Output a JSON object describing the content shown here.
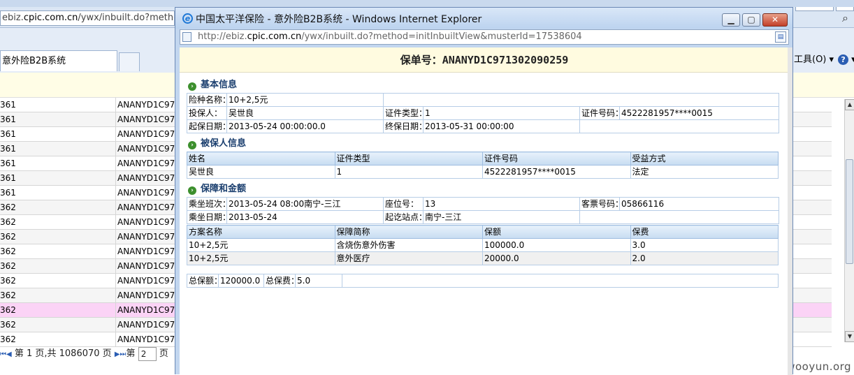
{
  "background": {
    "address_url_prefix": "ebiz.",
    "address_url_domain": "cpic.com.cn",
    "address_url_rest": "/ywx/inbuilt.do?method=",
    "tab_label": "意外险B2B系统",
    "tools_menu": "工具(O) ▾",
    "help_label": "?",
    "rows": [
      {
        "c1": "361",
        "c2": "ANANYD1C97"
      },
      {
        "c1": "361",
        "c2": "ANANYD1C97"
      },
      {
        "c1": "361",
        "c2": "ANANYD1C97"
      },
      {
        "c1": "361",
        "c2": "ANANYD1C97"
      },
      {
        "c1": "361",
        "c2": "ANANYD1C97"
      },
      {
        "c1": "361",
        "c2": "ANANYD1C97"
      },
      {
        "c1": "361",
        "c2": "ANANYD1C97"
      },
      {
        "c1": "362",
        "c2": "ANANYD1C97"
      },
      {
        "c1": "362",
        "c2": "ANANYD1C97"
      },
      {
        "c1": "362",
        "c2": "ANANYD1C97"
      },
      {
        "c1": "362",
        "c2": "ANANYD1C97"
      },
      {
        "c1": "362",
        "c2": "ANANYD1C97"
      },
      {
        "c1": "362",
        "c2": "ANANYD1C97"
      },
      {
        "c1": "362",
        "c2": "ANANYD1C97"
      },
      {
        "c1": "362",
        "c2": "ANANYD1C97"
      },
      {
        "c1": "362",
        "c2": "ANANYD1C97"
      },
      {
        "c1": "362",
        "c2": "ANANYD1C97"
      }
    ],
    "highlight_row_index": 14,
    "pager": {
      "first_icon": "⏮",
      "prev_icon": "◀",
      "text": "第 1 页,共 1086070 页",
      "next_icon": "▶",
      "last_icon": "⏭",
      "goto_prefix": "第",
      "goto_value": "2",
      "goto_suffix": "页"
    }
  },
  "popup": {
    "title": "中国太平洋保险 - 意外险B2B系统 - Windows Internet Explorer",
    "url_prefix": "http://ebiz.",
    "url_domain": "cpic.com.cn",
    "url_rest": "/ywx/inbuilt.do?method=initInbuiltView&musterId=17538604",
    "policy_label": "保单号：",
    "policy_no": "ANANYD1C971302090259",
    "basic": {
      "title": "基本信息",
      "insurance_name_label": "险种名称：",
      "insurance_name": "10+2,5元",
      "applicant_label": "投保人：",
      "applicant": "吴世良",
      "id_type_label": "证件类型：",
      "id_type": "1",
      "id_no_label": "证件号码：",
      "id_no": "4522281957****0015",
      "start_label": "起保日期：",
      "start": "2013-05-24 00:00:00.0",
      "end_label": "终保日期：",
      "end": "2013-05-31 00:00:00"
    },
    "insured": {
      "title": "被保人信息",
      "headers": [
        "姓名",
        "证件类型",
        "证件号码",
        "受益方式"
      ],
      "row": [
        "吴世良",
        "1",
        "4522281957****0015",
        "法定"
      ]
    },
    "coverage": {
      "title": "保障和金额",
      "trip_label": "乘坐班次：",
      "trip": "2013-05-24 08:00南宁-三江",
      "seat_label": "座位号：",
      "seat": "13",
      "ticket_label": "客票号码：",
      "ticket": "05866116",
      "date_label": "乘坐日期：",
      "date": "2013-05-24",
      "route_label": "起讫站点：",
      "route": "南宁-三江",
      "headers": [
        "方案名称",
        "保障简称",
        "保额",
        "保费"
      ],
      "rows": [
        [
          "10+2,5元",
          "含烧伤意外伤害",
          "100000.0",
          "3.0"
        ],
        [
          "10+2,5元",
          "意外医疗",
          "20000.0",
          "2.0"
        ]
      ],
      "total_amount_label": "总保额：",
      "total_amount": "120000.0",
      "total_premium_label": "总保费：",
      "total_premium": "5.0"
    }
  },
  "watermark": "www.wooyun.org"
}
